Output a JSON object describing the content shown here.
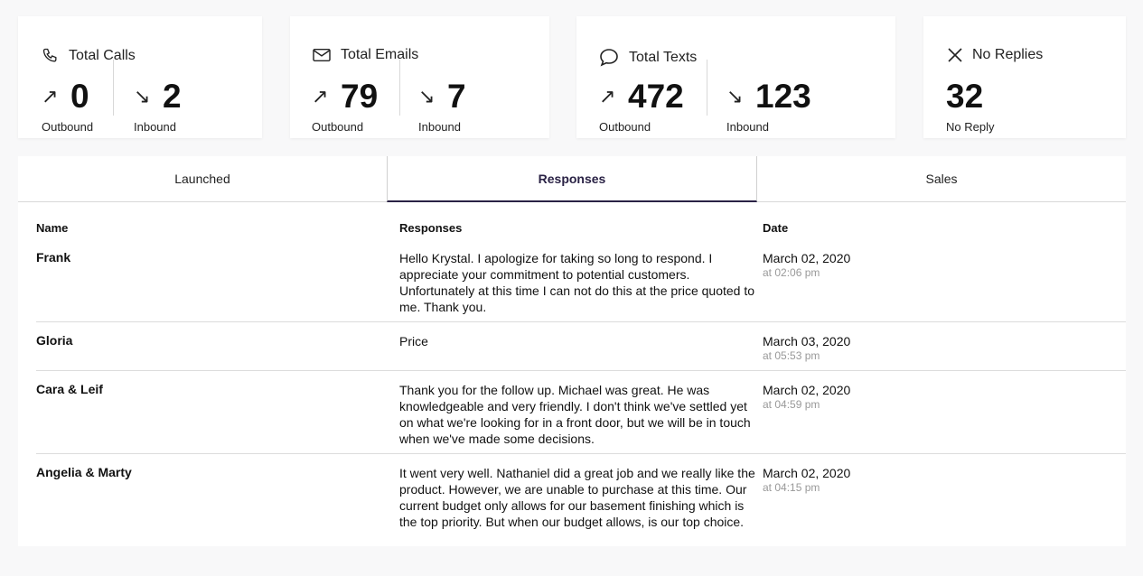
{
  "stats": {
    "calls": {
      "title": "Total Calls",
      "icon": "phone-icon",
      "outbound_value": "0",
      "outbound_label": "Outbound",
      "inbound_value": "2",
      "inbound_label": "Inbound"
    },
    "emails": {
      "title": "Total Emails",
      "icon": "envelope-icon",
      "outbound_value": "79",
      "outbound_label": "Outbound",
      "inbound_value": "7",
      "inbound_label": "Inbound"
    },
    "texts": {
      "title": "Total Texts",
      "icon": "chat-bubble-icon",
      "outbound_value": "472",
      "outbound_label": "Outbound",
      "inbound_value": "123",
      "inbound_label": "Inbound"
    },
    "noreply": {
      "title": "No Replies",
      "icon": "close-icon",
      "value": "32",
      "label": "No Reply"
    }
  },
  "arrows": {
    "outbound": "↗",
    "inbound": "↘"
  },
  "tabs": [
    {
      "label": "Launched"
    },
    {
      "label": "Responses"
    },
    {
      "label": "Sales"
    }
  ],
  "table": {
    "headers": {
      "name": "Name",
      "responses": "Responses",
      "date": "Date"
    },
    "rows": [
      {
        "name": "Frank",
        "response": "Hello Krystal. I apologize for taking so long to respond. I appreciate your commitment to potential customers. Unfortunately at this time I can not do this at the price quoted to me. Thank you.",
        "date": "March 02, 2020",
        "time": "at 02:06 pm"
      },
      {
        "name": "Gloria",
        "response": "Price",
        "date": "March 03, 2020",
        "time": "at 05:53 pm"
      },
      {
        "name": "Cara & Leif",
        "response": "Thank you for the follow up. Michael was great. He was knowledgeable and very friendly. I don't think we've settled yet on what we're looking for in a front door, but we will be in touch when we've made some decisions.",
        "date": "March 02, 2020",
        "time": "at 04:59 pm"
      },
      {
        "name": "Angelia & Marty",
        "response": "It went very well. Nathaniel did a great job and we really like the product. However, we are unable to purchase at this time. Our current budget only allows for our basement finishing which is the top priority. But when our budget allows, is our top choice.",
        "date": "March 02, 2020",
        "time": "at 04:15 pm"
      }
    ]
  }
}
